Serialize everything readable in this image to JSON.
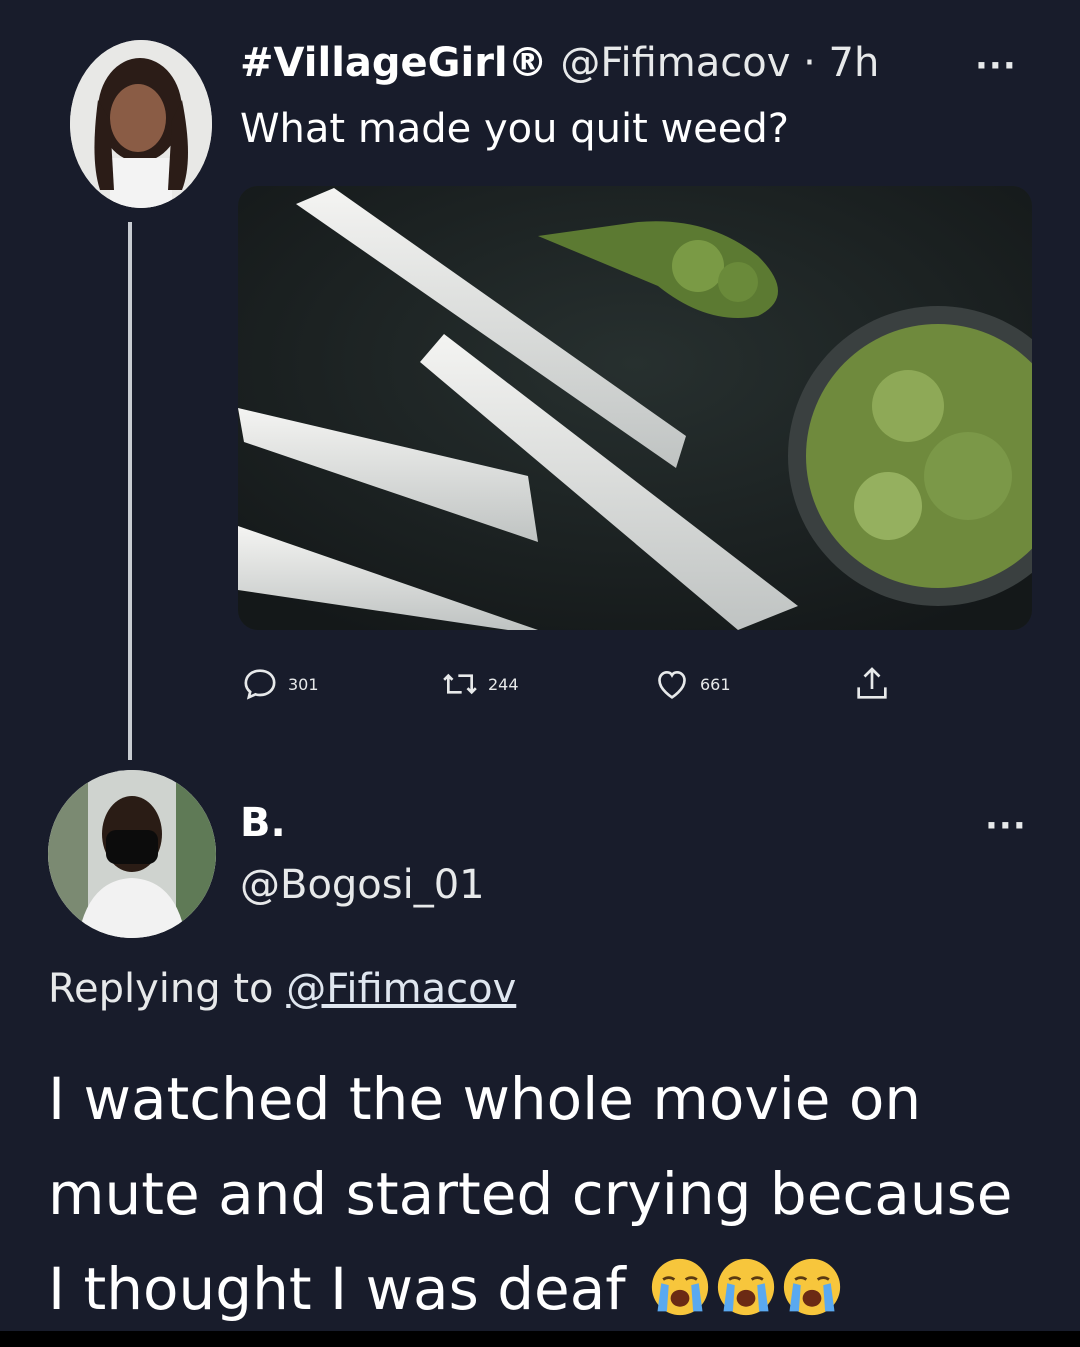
{
  "tweet": {
    "author": {
      "display_name": "#VillageGirl®",
      "handle": "@Fifimacov",
      "time": "· 7h"
    },
    "text": "What made you quit weed?",
    "more_label": "···",
    "stats": {
      "replies": "301",
      "retweets": "244",
      "likes": "661"
    }
  },
  "reply": {
    "author": {
      "display_name": "B.",
      "handle": "@Bogosi_01"
    },
    "more_label": "···",
    "replying_to_label": "Replying to",
    "replying_to_handle": "@Fifimacov",
    "text": "I watched the whole movie on mute and started crying because I thought I was deaf",
    "emoji_count": 3,
    "emoji_name": "loudly-crying-face"
  },
  "colors": {
    "background": "#181c2b",
    "text": "#e7e9ea"
  },
  "icons": [
    "reply-icon",
    "retweet-icon",
    "like-icon",
    "share-icon",
    "more-icon"
  ]
}
